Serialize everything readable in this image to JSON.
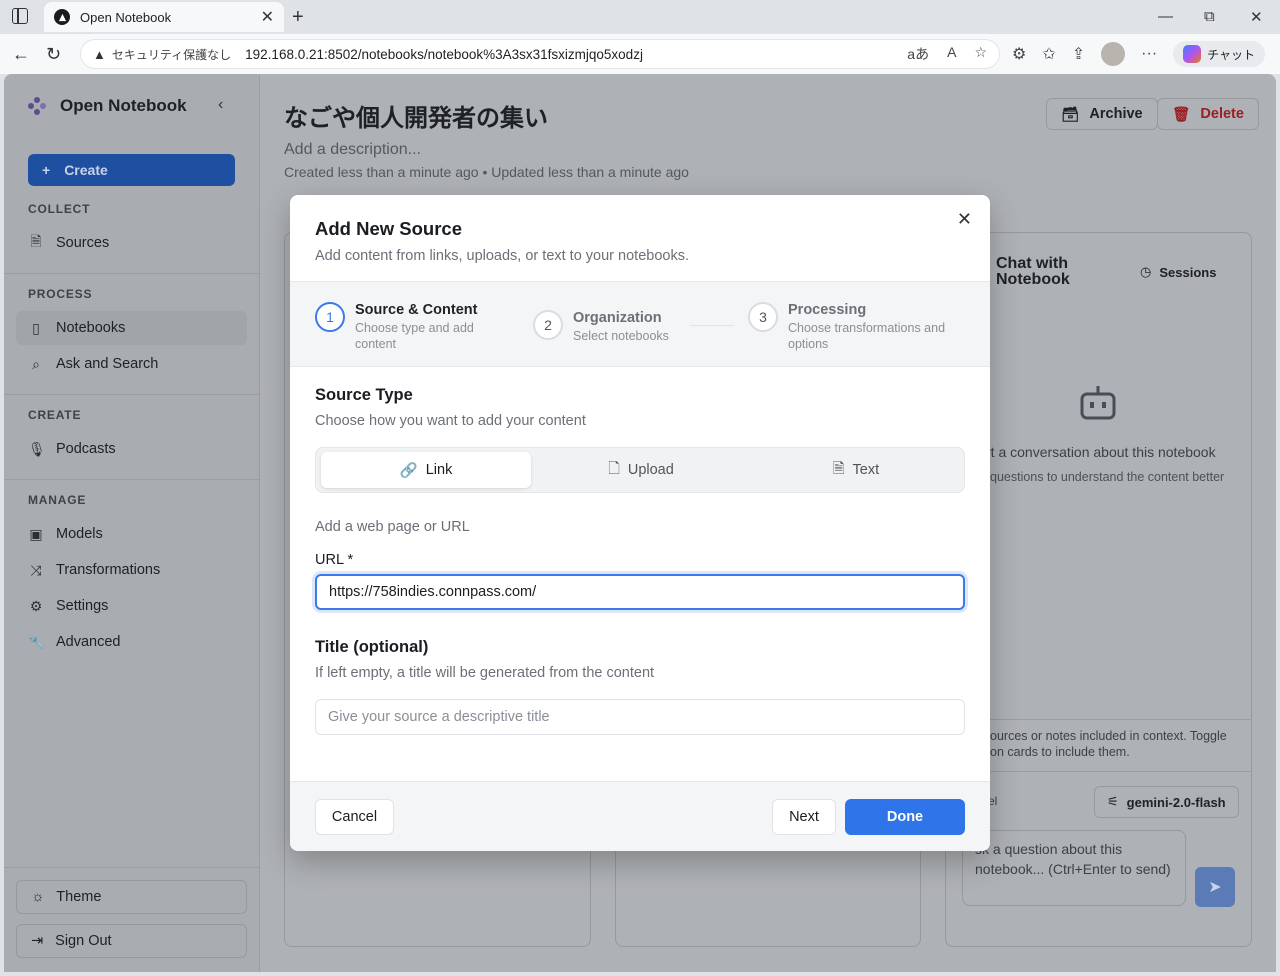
{
  "browser": {
    "tab_title": "Open Notebook",
    "security_label": "セキュリティ保護なし",
    "url": "192.168.0.21:8502/notebooks/notebook%3A3sx31fsxizmjqo5xodzj",
    "copilot_label": "チャット"
  },
  "sidebar": {
    "brand": "Open Notebook",
    "create_label": "Create",
    "sections": {
      "collect": "COLLECT",
      "process": "PROCESS",
      "create": "CREATE",
      "manage": "MANAGE"
    },
    "items": {
      "sources": "Sources",
      "notebooks": "Notebooks",
      "ask_search": "Ask and Search",
      "podcasts": "Podcasts",
      "models": "Models",
      "transformations": "Transformations",
      "settings": "Settings",
      "advanced": "Advanced"
    },
    "theme_label": "Theme",
    "signout_label": "Sign Out"
  },
  "notebook": {
    "title": "なごや個人開発者の集い",
    "description_placeholder": "Add a description...",
    "meta": "Created less than a minute ago • Updated less than a minute ago",
    "archive_label": "Archive",
    "delete_label": "Delete"
  },
  "chat": {
    "title_line1": "Chat with",
    "title_line2": "Notebook",
    "sessions_label": "Sessions",
    "empty_title": "rt a conversation about this notebook",
    "empty_sub": "questions to understand the content better",
    "context_hint": "ources or notes included in context. Toggle on cards to include them.",
    "model_label": "el",
    "model_name": "gemini-2.0-flash",
    "input_placeholder": "sk a question about this notebook... (Ctrl+Enter to send)"
  },
  "modal": {
    "title": "Add New Source",
    "subtitle": "Add content from links, uploads, or text to your notebooks.",
    "steps": [
      {
        "number": "1",
        "name": "Source & Content",
        "desc": "Choose type and add content"
      },
      {
        "number": "2",
        "name": "Organization",
        "desc": "Select notebooks"
      },
      {
        "number": "3",
        "name": "Processing",
        "desc": "Choose transformations and options"
      }
    ],
    "source_type_title": "Source Type",
    "source_type_sub": "Choose how you want to add your content",
    "types": {
      "link": "Link",
      "upload": "Upload",
      "text": "Text"
    },
    "link_hint": "Add a web page or URL",
    "url_label": "URL *",
    "url_value": "https://758indies.connpass.com/",
    "title_section": "Title (optional)",
    "title_sub": "If left empty, a title will be generated from the content",
    "title_placeholder": "Give your source a descriptive title",
    "cancel_label": "Cancel",
    "next_label": "Next",
    "done_label": "Done"
  },
  "colors": {
    "primary": "#2f74e8",
    "delete": "#c0262d",
    "sidebar_create": "#1f4fa0"
  }
}
